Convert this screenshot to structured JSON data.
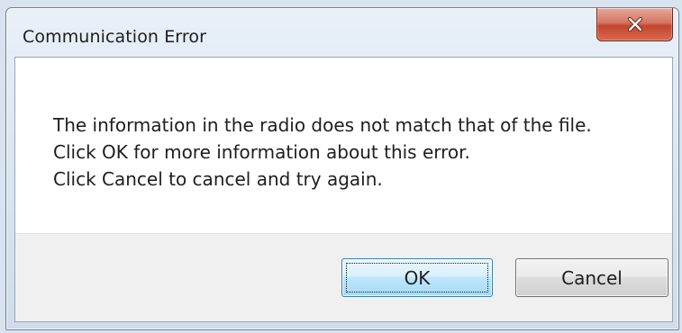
{
  "dialog": {
    "title": "Communication Error",
    "close_icon": "close-x-icon",
    "message_lines": [
      "The information in the radio does not match that of the file.",
      "Click OK for more information about this error.",
      "Click Cancel to cancel and try again."
    ],
    "buttons": {
      "ok_label": "OK",
      "cancel_label": "Cancel"
    }
  },
  "colors": {
    "close_button": "#c4452f",
    "default_button_border": "#3c7fb1",
    "button_bar": "#f0f0f0"
  }
}
